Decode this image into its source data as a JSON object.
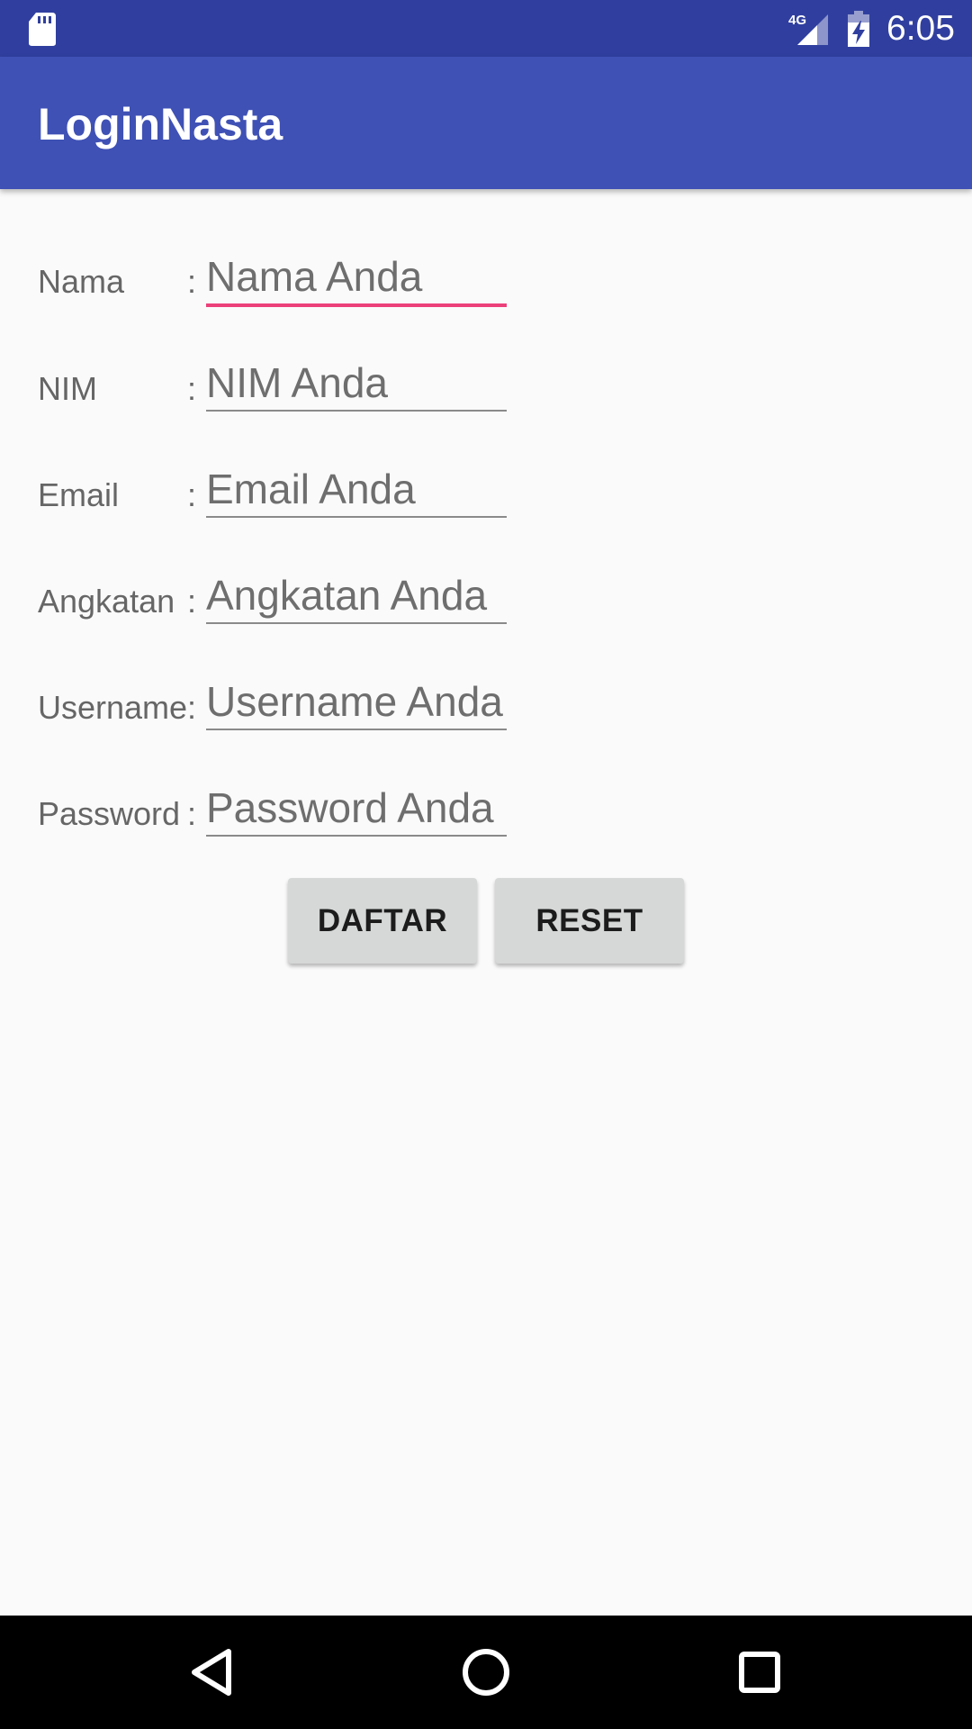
{
  "status_bar": {
    "network_label": "4G",
    "time": "6:05"
  },
  "app_bar": {
    "title": "LoginNasta"
  },
  "form": {
    "separator": ":",
    "fields": [
      {
        "label": "Nama",
        "placeholder": "Nama Anda",
        "focused": true
      },
      {
        "label": "NIM",
        "placeholder": "NIM Anda",
        "focused": false
      },
      {
        "label": "Email",
        "placeholder": "Email Anda",
        "focused": false
      },
      {
        "label": "Angkatan",
        "placeholder": "Angkatan Anda",
        "focused": false
      },
      {
        "label": "Username",
        "placeholder": "Username Anda",
        "focused": false
      },
      {
        "label": "Password",
        "placeholder": "Password Anda",
        "focused": false
      }
    ]
  },
  "buttons": {
    "submit_label": "DAFTAR",
    "reset_label": "RESET"
  },
  "icons": {
    "status_left": "sd-card-icon",
    "signal": "signal-4g-icon",
    "battery": "battery-charging-icon",
    "nav_back": "back-triangle-icon",
    "nav_home": "home-circle-icon",
    "nav_recents": "recents-square-icon"
  },
  "colors": {
    "status_bar": "#303f9f",
    "app_bar": "#3f51b5",
    "focus_underline": "#ec407a",
    "button_bg": "#d6d7d7"
  }
}
